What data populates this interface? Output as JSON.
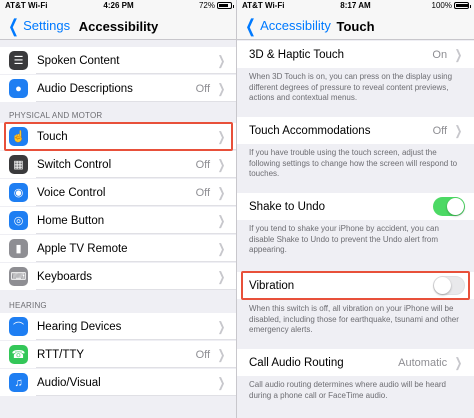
{
  "colors": {
    "accent": "#007aff",
    "toggle_on": "#4cd964",
    "highlight": "#e8503a"
  },
  "left": {
    "status": {
      "carrier": "AT&T Wi-Fi",
      "time": "4:26 PM",
      "battery": "72%"
    },
    "nav": {
      "back": "Settings",
      "title": "Accessibility"
    },
    "rows_top": [
      {
        "label": "Spoken Content",
        "value": "",
        "icon": "speech-bubble-icon",
        "color": "#3a3a3c"
      },
      {
        "label": "Audio Descriptions",
        "value": "Off",
        "icon": "audio-description-icon",
        "color": "#1e7ef2"
      }
    ],
    "section_physical": "PHYSICAL AND MOTOR",
    "rows_physical": [
      {
        "label": "Touch",
        "value": "",
        "icon": "hand-pointer-icon",
        "color": "#1e7ef2"
      },
      {
        "label": "Switch Control",
        "value": "Off",
        "icon": "grid-icon",
        "color": "#3a3a3c"
      },
      {
        "label": "Voice Control",
        "value": "Off",
        "icon": "voice-control-icon",
        "color": "#1e7ef2"
      },
      {
        "label": "Home Button",
        "value": "",
        "icon": "home-button-icon",
        "color": "#1e7ef2"
      },
      {
        "label": "Apple TV Remote",
        "value": "",
        "icon": "remote-icon",
        "color": "#8e8e93"
      },
      {
        "label": "Keyboards",
        "value": "",
        "icon": "keyboard-icon",
        "color": "#8e8e93"
      }
    ],
    "section_hearing": "HEARING",
    "rows_hearing": [
      {
        "label": "Hearing Devices",
        "value": "",
        "icon": "ear-icon",
        "color": "#1e7ef2"
      },
      {
        "label": "RTT/TTY",
        "value": "Off",
        "icon": "tty-icon",
        "color": "#34c759"
      },
      {
        "label": "Audio/Visual",
        "value": "",
        "icon": "speaker-icon",
        "color": "#1e7ef2"
      }
    ]
  },
  "right": {
    "status": {
      "carrier": "AT&T Wi-Fi",
      "time": "8:17 AM",
      "battery": "100%"
    },
    "nav": {
      "back": "Accessibility",
      "title": "Touch"
    },
    "haptic": {
      "label": "3D & Haptic Touch",
      "value": "On"
    },
    "haptic_footer": "When 3D Touch is on, you can press on the display using different degrees of pressure to reveal content previews, actions and contextual menus.",
    "accommodations": {
      "label": "Touch Accommodations",
      "value": "Off"
    },
    "accommodations_footer": "If you have trouble using the touch screen, adjust the following settings to change how the screen will respond to touches.",
    "shake": {
      "label": "Shake to Undo",
      "state": "on"
    },
    "shake_footer": "If you tend to shake your iPhone by accident, you can disable Shake to Undo to prevent the Undo alert from appearing.",
    "vibration": {
      "label": "Vibration",
      "state": "off"
    },
    "vibration_footer": "When this switch is off, all vibration on your iPhone will be disabled, including those for earthquake, tsunami and other emergency alerts.",
    "audio_routing": {
      "label": "Call Audio Routing",
      "value": "Automatic"
    },
    "audio_routing_footer": "Call audio routing determines where audio will be heard during a phone call or FaceTime audio."
  }
}
